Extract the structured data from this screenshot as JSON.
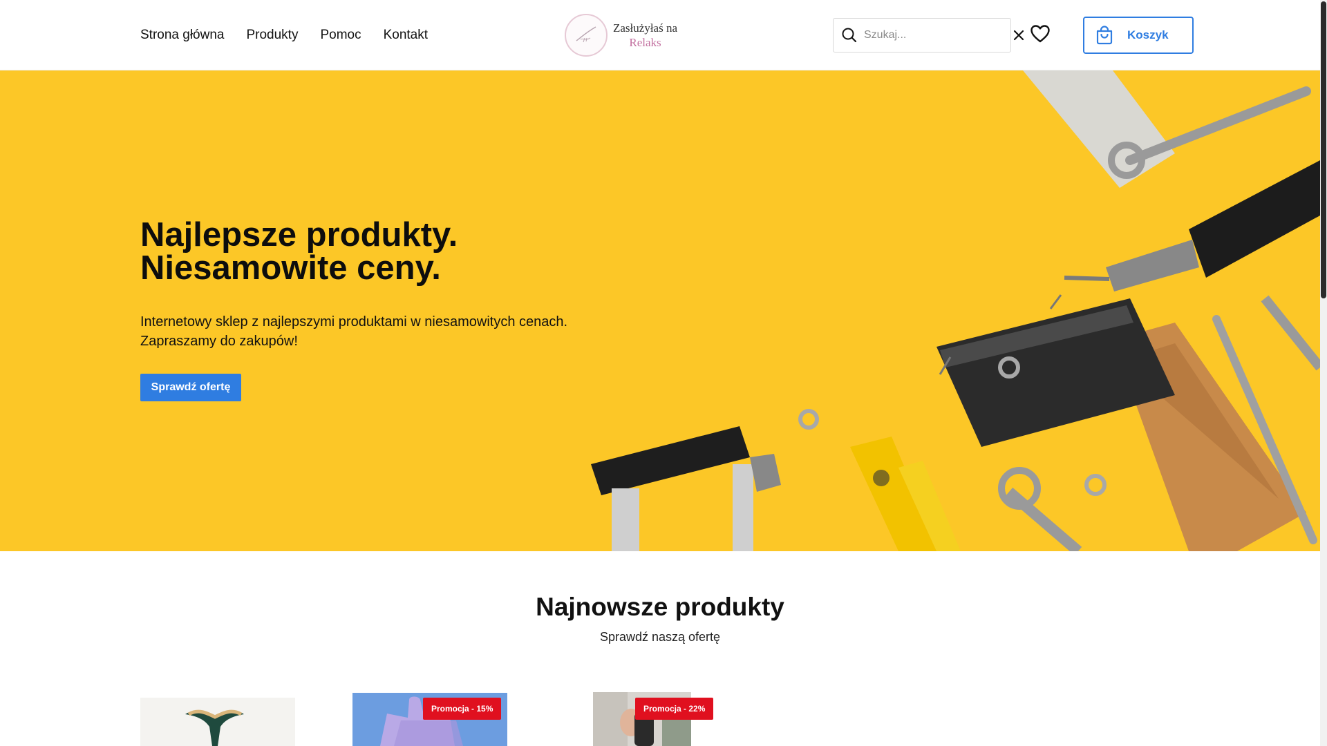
{
  "header": {
    "nav": [
      "Strona główna",
      "Produkty",
      "Pomoc",
      "Kontakt"
    ],
    "logo": {
      "line1": "Zasłużyłaś na",
      "line2": "Relaks"
    },
    "search": {
      "placeholder": "Szukaj...",
      "value": ""
    },
    "cart_label": "Koszyk"
  },
  "hero": {
    "title_line1": "Najlepsze produkty.",
    "title_line2": "Niesamowite ceny.",
    "desc_line1": "Internetowy sklep z najlepszymi produktami w niesamowitych cenach.",
    "desc_line2": "Zapraszamy do zakupów!",
    "cta": "Sprawdź ofertę"
  },
  "section": {
    "title": "Najnowsze produkty",
    "subtitle": "Sprawdź naszą ofertę"
  },
  "products": [
    {
      "badge": ""
    },
    {
      "badge": "Promocja - 15%"
    },
    {
      "badge": "Promocja - 22%"
    }
  ],
  "colors": {
    "accent": "#2f7de1",
    "hero_bg": "#fcc727",
    "badge": "#e0101f"
  },
  "icons": [
    "search-icon",
    "close-icon",
    "heart-icon",
    "shopping-bag-icon",
    "logo-icon"
  ]
}
